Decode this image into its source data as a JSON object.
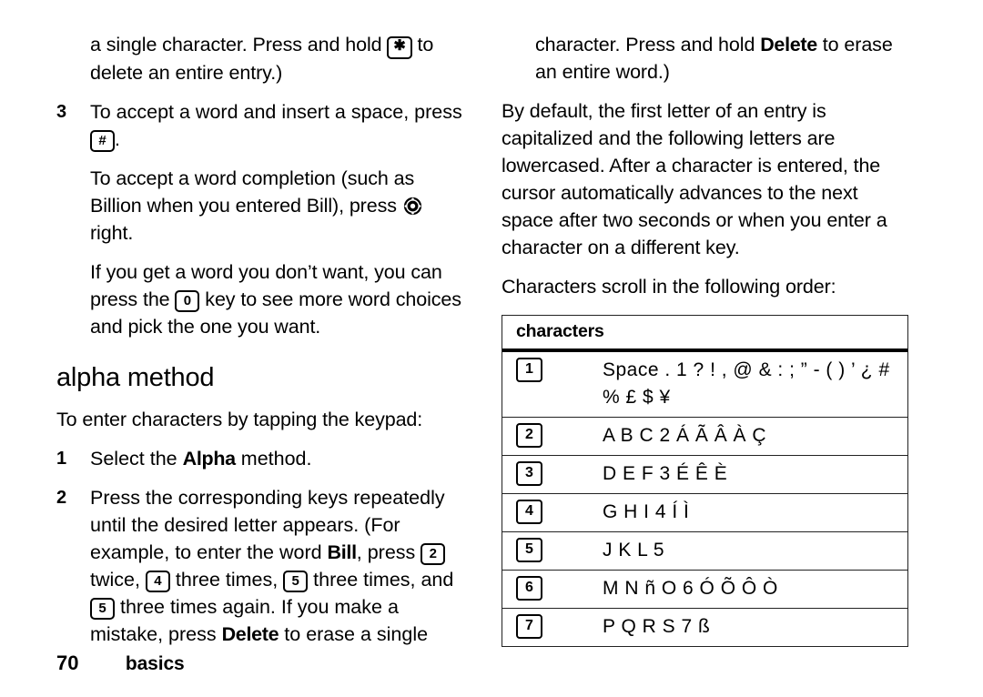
{
  "page": {
    "number": "70",
    "section": "basics"
  },
  "left_column": {
    "blocks": [
      {
        "type": "para",
        "indent": true,
        "runs": [
          {
            "t": "text",
            "v": "a single character. Press and hold "
          },
          {
            "t": "key",
            "v": "✱",
            "name": "star-key-icon"
          },
          {
            "t": "text",
            "v": " to delete an entire entry.)"
          }
        ]
      },
      {
        "type": "step",
        "num": "3",
        "runs": [
          {
            "t": "text",
            "v": "To accept a word and insert a space, press "
          },
          {
            "t": "key",
            "v": "#",
            "name": "pound-key-icon"
          },
          {
            "t": "text",
            "v": "."
          }
        ]
      },
      {
        "type": "para",
        "indent": true,
        "runs": [
          {
            "t": "text",
            "v": "To accept a word completion (such as Billion when you entered Bill), press "
          },
          {
            "t": "navkey",
            "v": "",
            "name": "navigation-key-icon"
          },
          {
            "t": "text",
            "v": " right."
          }
        ]
      },
      {
        "type": "para",
        "indent": true,
        "runs": [
          {
            "t": "text",
            "v": "If you get a word you don’t want, you can press the "
          },
          {
            "t": "key",
            "v": "0",
            "name": "zero-key-icon"
          },
          {
            "t": "text",
            "v": " key to see more word choices and pick the one you want."
          }
        ]
      },
      {
        "type": "heading",
        "runs": [
          {
            "t": "text",
            "v": "alpha method"
          }
        ]
      },
      {
        "type": "para",
        "indent": false,
        "runs": [
          {
            "t": "text",
            "v": "To enter characters by tapping the keypad:"
          }
        ]
      },
      {
        "type": "step",
        "num": "1",
        "runs": [
          {
            "t": "text",
            "v": "Select the "
          },
          {
            "t": "bold",
            "v": "Alpha"
          },
          {
            "t": "text",
            "v": " method."
          }
        ]
      },
      {
        "type": "step",
        "num": "2",
        "runs": [
          {
            "t": "text",
            "v": "Press the corresponding keys repeatedly until the desired letter appears. (For example, to enter the word "
          },
          {
            "t": "bold",
            "v": "Bill"
          },
          {
            "t": "text",
            "v": ", press "
          },
          {
            "t": "key",
            "v": "2",
            "name": "two-key-icon"
          },
          {
            "t": "text",
            "v": " twice, "
          },
          {
            "t": "key",
            "v": "4",
            "name": "four-key-icon"
          },
          {
            "t": "text",
            "v": " three times, "
          },
          {
            "t": "key",
            "v": "5",
            "name": "five-key-icon"
          },
          {
            "t": "text",
            "v": " three times, and "
          },
          {
            "t": "key",
            "v": "5",
            "name": "five-key-icon"
          },
          {
            "t": "text",
            "v": " three times again. If you make a mistake, press "
          },
          {
            "t": "bold",
            "v": "Delete"
          },
          {
            "t": "text",
            "v": " to erase a single"
          }
        ]
      }
    ]
  },
  "right_column": {
    "blocks": [
      {
        "type": "para",
        "indent": true,
        "runs": [
          {
            "t": "text",
            "v": "character. Press and hold "
          },
          {
            "t": "bold",
            "v": "Delete"
          },
          {
            "t": "text",
            "v": " to erase an entire word.)"
          }
        ]
      },
      {
        "type": "para",
        "indent": false,
        "runs": [
          {
            "t": "text",
            "v": "By default, the first letter of an entry is capitalized and the following letters are lowercased. After a character is entered, the cursor automatically advances to the next space after two seconds or when you enter a character on a different key."
          }
        ]
      },
      {
        "type": "para",
        "indent": false,
        "runs": [
          {
            "t": "text",
            "v": "Characters scroll in the following order:"
          }
        ]
      }
    ]
  },
  "characters_table": {
    "header": "characters",
    "rows": [
      {
        "key": "1",
        "chars": "Space . 1 ? ! , @ & : ; ” - ( ) ’ ¿ # %  £ $ ¥"
      },
      {
        "key": "2",
        "chars": "A B C 2 Á Ã Â À Ç"
      },
      {
        "key": "3",
        "chars": "D E F 3 É Ê È"
      },
      {
        "key": "4",
        "chars": "G H I 4 Í Ì"
      },
      {
        "key": "5",
        "chars": "J K L 5"
      },
      {
        "key": "6",
        "chars": "M N ñ O 6 Ó Õ Ô Ò"
      },
      {
        "key": "7",
        "chars": "P Q R S 7 ß"
      }
    ]
  }
}
